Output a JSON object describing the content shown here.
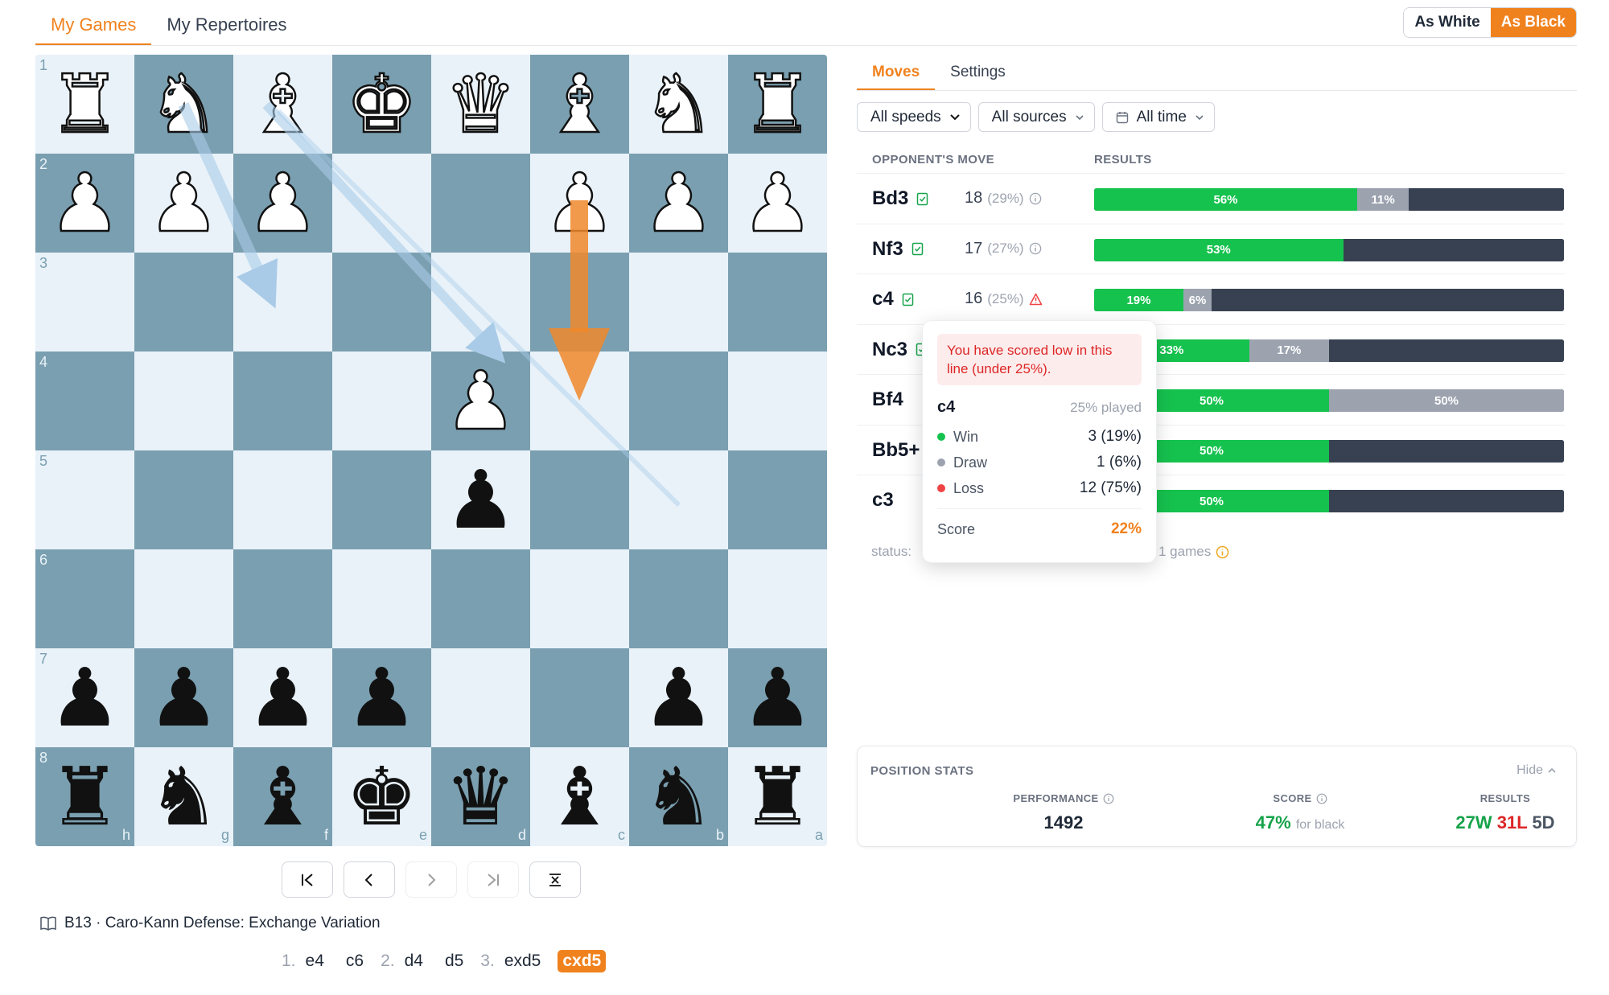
{
  "top_tabs": [
    {
      "label": "My Games",
      "active": true
    },
    {
      "label": "My Repertoires",
      "active": false
    }
  ],
  "color_toggle": {
    "white": "As White",
    "black": "As Black",
    "selected": "As Black"
  },
  "board": {
    "rank_labels": [
      "1",
      "2",
      "3",
      "4",
      "5",
      "6",
      "7",
      "8"
    ],
    "file_labels": [
      "h",
      "g",
      "f",
      "e",
      "d",
      "c",
      "b",
      "a"
    ],
    "squares": [
      [
        {
          "p": "♜",
          "c": "w"
        },
        {
          "p": "♞",
          "c": "w"
        },
        {
          "p": "♝",
          "c": "w"
        },
        {
          "p": "♚",
          "c": "w"
        },
        {
          "p": "♛",
          "c": "w"
        },
        {
          "p": "♝",
          "c": "w"
        },
        {
          "p": "♞",
          "c": "w"
        },
        {
          "p": "♜",
          "c": "w"
        }
      ],
      [
        {
          "p": "♟",
          "c": "w"
        },
        {
          "p": "♟",
          "c": "w"
        },
        {
          "p": "♟",
          "c": "w"
        },
        null,
        null,
        {
          "p": "♟",
          "c": "w"
        },
        {
          "p": "♟",
          "c": "w"
        },
        {
          "p": "♟",
          "c": "w"
        }
      ],
      [
        null,
        null,
        null,
        null,
        null,
        null,
        null,
        null
      ],
      [
        null,
        null,
        null,
        null,
        {
          "p": "♟",
          "c": "w"
        },
        null,
        null,
        null
      ],
      [
        null,
        null,
        null,
        null,
        {
          "p": "♟",
          "c": "b"
        },
        null,
        null,
        null
      ],
      [
        null,
        null,
        null,
        null,
        null,
        null,
        null,
        null
      ],
      [
        {
          "p": "♟",
          "c": "b"
        },
        {
          "p": "♟",
          "c": "b"
        },
        {
          "p": "♟",
          "c": "b"
        },
        {
          "p": "♟",
          "c": "b"
        },
        null,
        null,
        {
          "p": "♟",
          "c": "b"
        },
        {
          "p": "♟",
          "c": "b"
        }
      ],
      [
        {
          "p": "♜",
          "c": "b"
        },
        {
          "p": "♞",
          "c": "b"
        },
        {
          "p": "♝",
          "c": "b"
        },
        {
          "p": "♚",
          "c": "b"
        },
        {
          "p": "♛",
          "c": "b"
        },
        {
          "p": "♝",
          "c": "b"
        },
        {
          "p": "♞",
          "c": "b"
        },
        {
          "p": "♜",
          "c": "b"
        }
      ]
    ]
  },
  "nav_buttons": [
    {
      "name": "first-move-button",
      "icon": "skip-back-icon",
      "disabled": false
    },
    {
      "name": "prev-move-button",
      "icon": "chevron-left-icon",
      "disabled": false
    },
    {
      "name": "next-move-button",
      "icon": "chevron-right-icon",
      "disabled": true
    },
    {
      "name": "last-move-button",
      "icon": "skip-forward-icon",
      "disabled": true
    },
    {
      "name": "flip-board-button",
      "icon": "flip-icon",
      "disabled": false
    }
  ],
  "opening": {
    "icon": "book-icon",
    "text": "B13 · Caro-Kann Defense: Exchange Variation"
  },
  "move_list": [
    {
      "num": "1.",
      "white": "e4",
      "black": "c6"
    },
    {
      "num": "2.",
      "white": "d4",
      "black": "d5"
    },
    {
      "num": "3.",
      "white": "exd5",
      "black": "cxd5"
    }
  ],
  "current_move": "cxd5",
  "panel_tabs": [
    {
      "label": "Moves",
      "active": true
    },
    {
      "label": "Settings",
      "active": false
    }
  ],
  "filters": {
    "speed": "All speeds",
    "source": "All sources",
    "time": "All time"
  },
  "columns": {
    "move": "OPPONENT'S MOVE",
    "results": "RESULTS"
  },
  "moves": [
    {
      "move": "Bd3",
      "count": "18",
      "pct": "(29%)",
      "flag": "info",
      "win": 56,
      "draw": 11,
      "loss": 33,
      "win_label": "56%",
      "draw_label": "11%",
      "loss_label": ""
    },
    {
      "move": "Nf3",
      "count": "17",
      "pct": "(27%)",
      "flag": "info",
      "win": 53,
      "draw": 0,
      "loss": 47,
      "win_label": "53%",
      "draw_label": "",
      "loss_label": ""
    },
    {
      "move": "c4",
      "count": "16",
      "pct": "(25%)",
      "flag": "warning",
      "win": 19,
      "draw": 6,
      "loss": 75,
      "win_label": "19%",
      "draw_label": "6%",
      "loss_label": ""
    },
    {
      "move": "Nc3",
      "count": "",
      "pct": "",
      "flag": "",
      "win": 33,
      "draw": 17,
      "loss": 50,
      "win_label": "33%",
      "draw_label": "17%",
      "loss_label": ""
    },
    {
      "move": "Bf4",
      "count": "",
      "pct": "",
      "flag": "",
      "win": 50,
      "draw": 50,
      "loss": 0,
      "win_label": "50%",
      "draw_label": "50%",
      "loss_label": ""
    },
    {
      "move": "Bb5+",
      "count": "",
      "pct": "",
      "flag": "",
      "win": 50,
      "draw": 0,
      "loss": 50,
      "win_label": "50%",
      "draw_label": "",
      "loss_label": ""
    },
    {
      "move": "c3",
      "count": "",
      "pct": "",
      "flag": "",
      "win": 50,
      "draw": 0,
      "loss": 50,
      "win_label": "50%",
      "draw_label": "",
      "loss_label": ""
    }
  ],
  "status_text": "status:",
  "games_text": "1 games",
  "tooltip": {
    "warning": "You have scored low in this line (under 25%).",
    "move": "c4",
    "played": "25% played",
    "win_label": "Win",
    "win_value": "3 (19%)",
    "draw_label": "Draw",
    "draw_value": "1 (6%)",
    "loss_label": "Loss",
    "loss_value": "12 (75%)",
    "score_label": "Score",
    "score_value": "22%"
  },
  "position_stats": {
    "title": "POSITION STATS",
    "hide": "Hide",
    "performance_label": "PERFORMANCE",
    "performance_value": "1492",
    "score_label": "SCORE",
    "score_value": "47%",
    "score_sub": "for black",
    "results_label": "RESULTS",
    "wins": "27W",
    "losses": "31L",
    "draws": "5D"
  },
  "colors": {
    "accent": "#f0821e",
    "win": "#16c24e",
    "draw": "#9ca3af",
    "loss": "#374151",
    "light_square": "#e9f2f9",
    "dark_square": "#7a9fb0"
  }
}
